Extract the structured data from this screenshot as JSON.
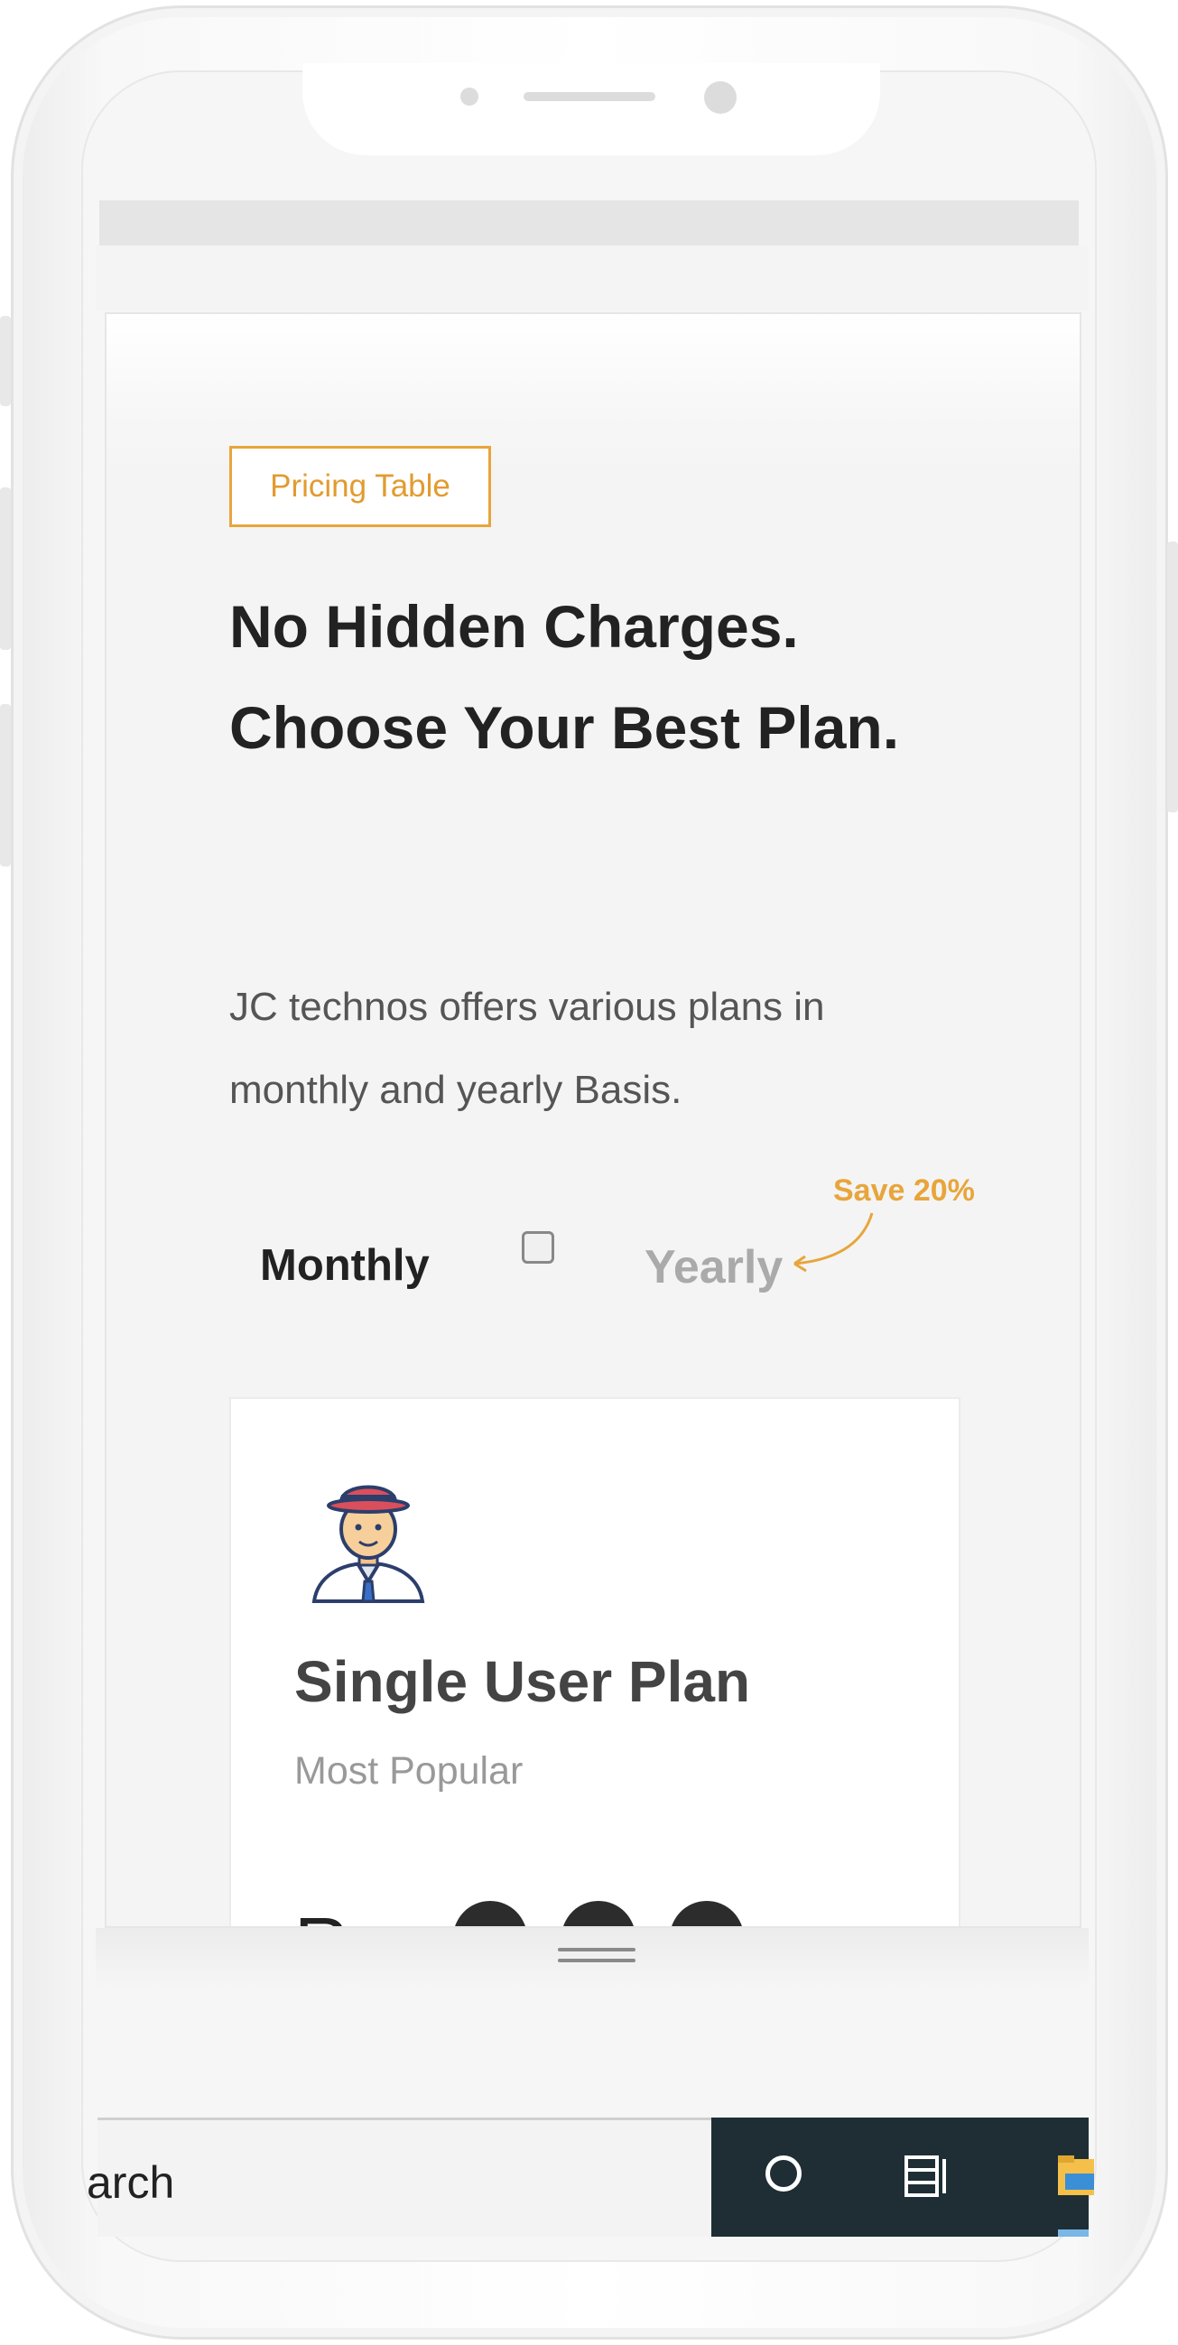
{
  "page": {
    "badge_label": "Pricing Table",
    "headline": "No Hidden Charges. Choose Your Best Plan.",
    "description": "JC technos offers various plans in monthly and yearly Basis."
  },
  "billing_toggle": {
    "monthly_label": "Monthly",
    "yearly_label": "Yearly",
    "save_note": "Save 20%",
    "yearly_selected": false
  },
  "plan_card": {
    "name": "Single User Plan",
    "subtitle": "Most Popular",
    "price_partial": "R",
    "icon": "user-avatar-hat-icon"
  },
  "taskbar": {
    "search_text": "arch",
    "icons": [
      "cortana-circle-icon",
      "task-view-icon",
      "file-explorer-icon"
    ],
    "dark_color": "#1f2e35"
  },
  "colors": {
    "accent": "#e8a53b",
    "heading": "#222222",
    "muted": "#999999"
  }
}
